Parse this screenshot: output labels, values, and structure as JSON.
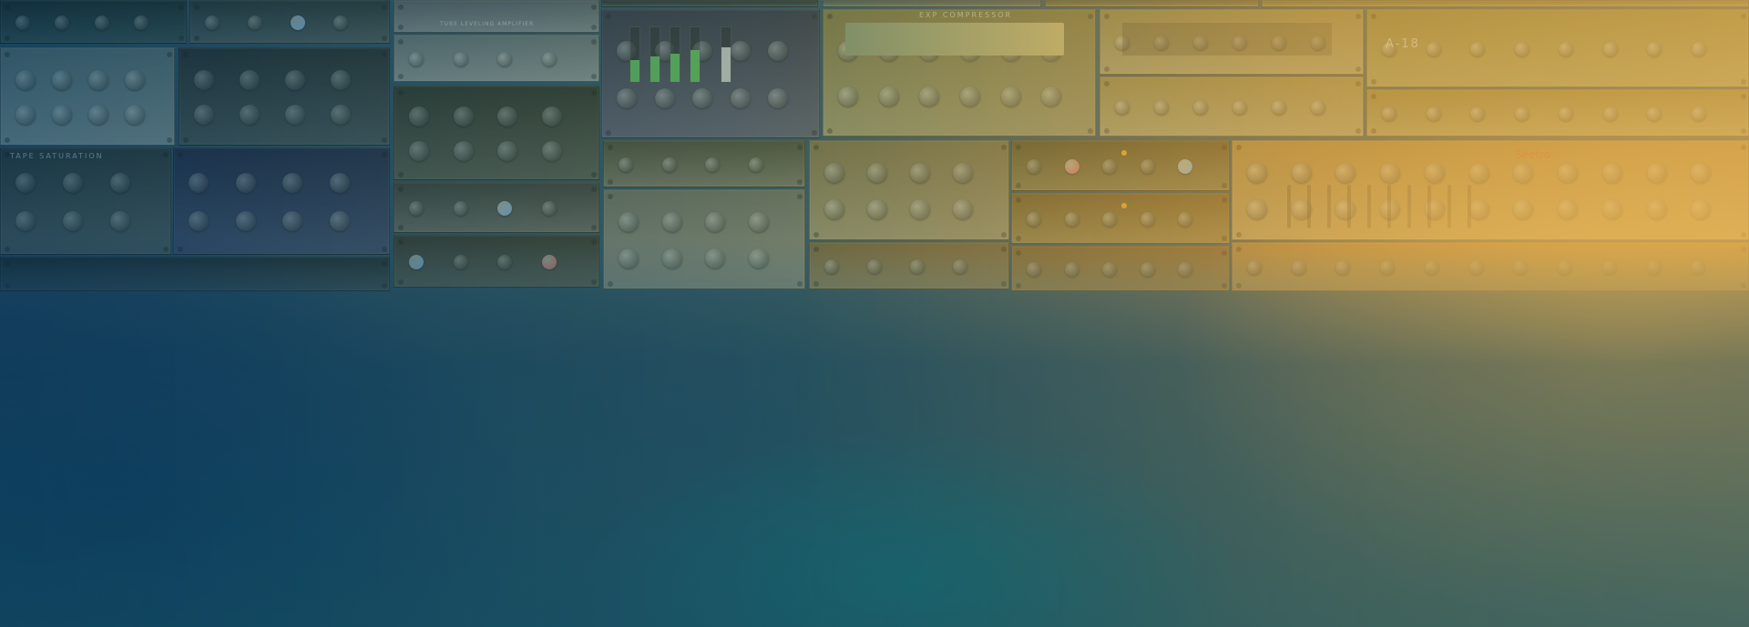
{
  "hero": {
    "background_colors": {
      "deep_blue": "#0f3f66",
      "teal": "#1f9a90",
      "amber": "#ecb252",
      "slate": "#3c4a5a"
    },
    "plugin_labels": {
      "tape_rack_label": "TAPE SATURATION",
      "compressor_label": "EXP COMPRESSOR",
      "amber_brand": "Seetro",
      "ab_label": "A-18",
      "top_center_label": "TUBE LEVELING AMPLIFIER"
    }
  }
}
